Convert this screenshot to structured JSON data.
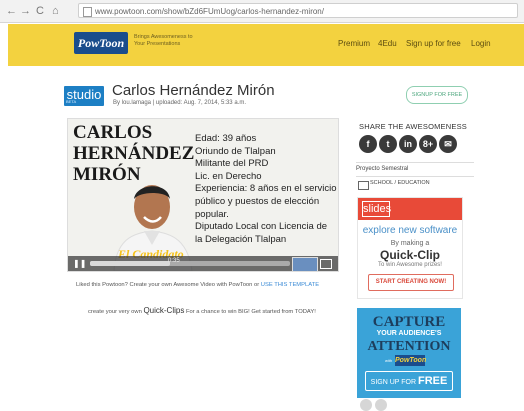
{
  "browser": {
    "url": "www.powtoon.com/show/bZd6FUmUog/carlos-hernandez-miron/"
  },
  "header": {
    "logo_text": "PowToon",
    "tagline": "Brings Awesomeness to Your Presentations",
    "nav": [
      "Premium",
      "4Edu",
      "Sign up for free",
      "Login"
    ]
  },
  "studio": {
    "badge": "studio",
    "beta": "BETA",
    "title": "Carlos Hernández Mirón",
    "byline": "By lou.lamaga | uploaded: Aug. 7, 2014, 5:33 a.m.",
    "signup_label": "SIGNUP FOR FREE"
  },
  "video": {
    "name_lines": [
      "CARLOS",
      "HERNÁNDEZ",
      "MIRÓN"
    ],
    "info_lines": [
      "Edad: 39 años",
      "Oriundo de Tlalpan",
      "Militante del PRD",
      "Lic. en Derecho",
      "Experiencia: 8 años en el servicio",
      "público y puestos de elección",
      "popular.",
      "Diputado Local con Licencia de",
      "la Delegación Tlalpan"
    ],
    "caption": "El Candidato",
    "time": "0:35",
    "progress_fraction": 0.4
  },
  "below": {
    "cta1_prefix": "Liked this Powtoon? Create your own Awesome Video with PowToon or",
    "cta1_link": "USE THIS TEMPLATE",
    "cta2_prefix": "create your very own",
    "cta2_big": "Quick-Clips",
    "cta2_suffix": "For a chance to win BIG! Get started from TODAY!"
  },
  "sidebar": {
    "share_title": "SHARE THE AWESOMENESS",
    "social_icons": [
      "f",
      "t",
      "in",
      "8+",
      "✉"
    ],
    "project": "Proyecto Semestral",
    "category": "SCHOOL / EDUCATION",
    "ad1": {
      "logo": "slides",
      "line1": "explore new software",
      "line2": "By making a",
      "line3": "Quick-Clip",
      "line4": "To win Awesome prizes!",
      "button": "START CREATING NOW!"
    },
    "ad2": {
      "line1": "CAPTURE",
      "line2": "YOUR AUDIENCE'S",
      "line3": "ATTENTION",
      "with": "with",
      "logo": "PowToon",
      "button_prefix": "SIGN UP FOR",
      "button_big": "FREE"
    }
  },
  "colors": {
    "header_bg": "#f3d23f",
    "studio_blue": "#1d7fc4",
    "ad_blue": "#3aa3d8",
    "slides_red": "#e84a38"
  }
}
